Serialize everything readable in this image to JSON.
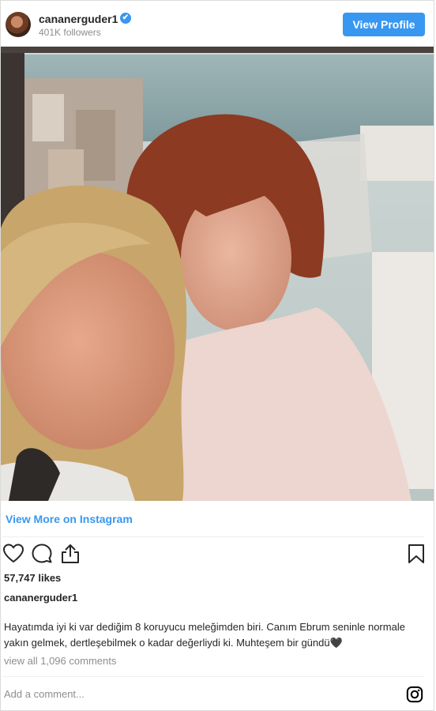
{
  "header": {
    "username": "cananerguder1",
    "verified_mark": "✔",
    "followers": "401K followers",
    "view_profile_label": "View Profile"
  },
  "post": {
    "photo_icon": "photo",
    "view_more_label": "View More on Instagram",
    "likes": "57,747 likes",
    "caption_username": "cananerguder1",
    "caption_text": "Hayatımda iyi ki var dediğim 8 koruyucu meleğimden biri. Canım Ebrum seninle normale yakın gelmek, dertleşebilmek o kadar değerliydi ki. Muhteşem bir gündü🖤",
    "view_comments_label": "view all 1,096 comments",
    "add_comment_placeholder": "Add a comment..."
  },
  "icons": {
    "like": "heart-icon",
    "comment": "comment-icon",
    "share": "share-icon",
    "save": "bookmark-icon",
    "brand": "instagram-icon"
  },
  "colors": {
    "accent": "#3897f0",
    "text": "#262626",
    "muted": "#8e8e8e",
    "border": "#dbdbdb"
  }
}
